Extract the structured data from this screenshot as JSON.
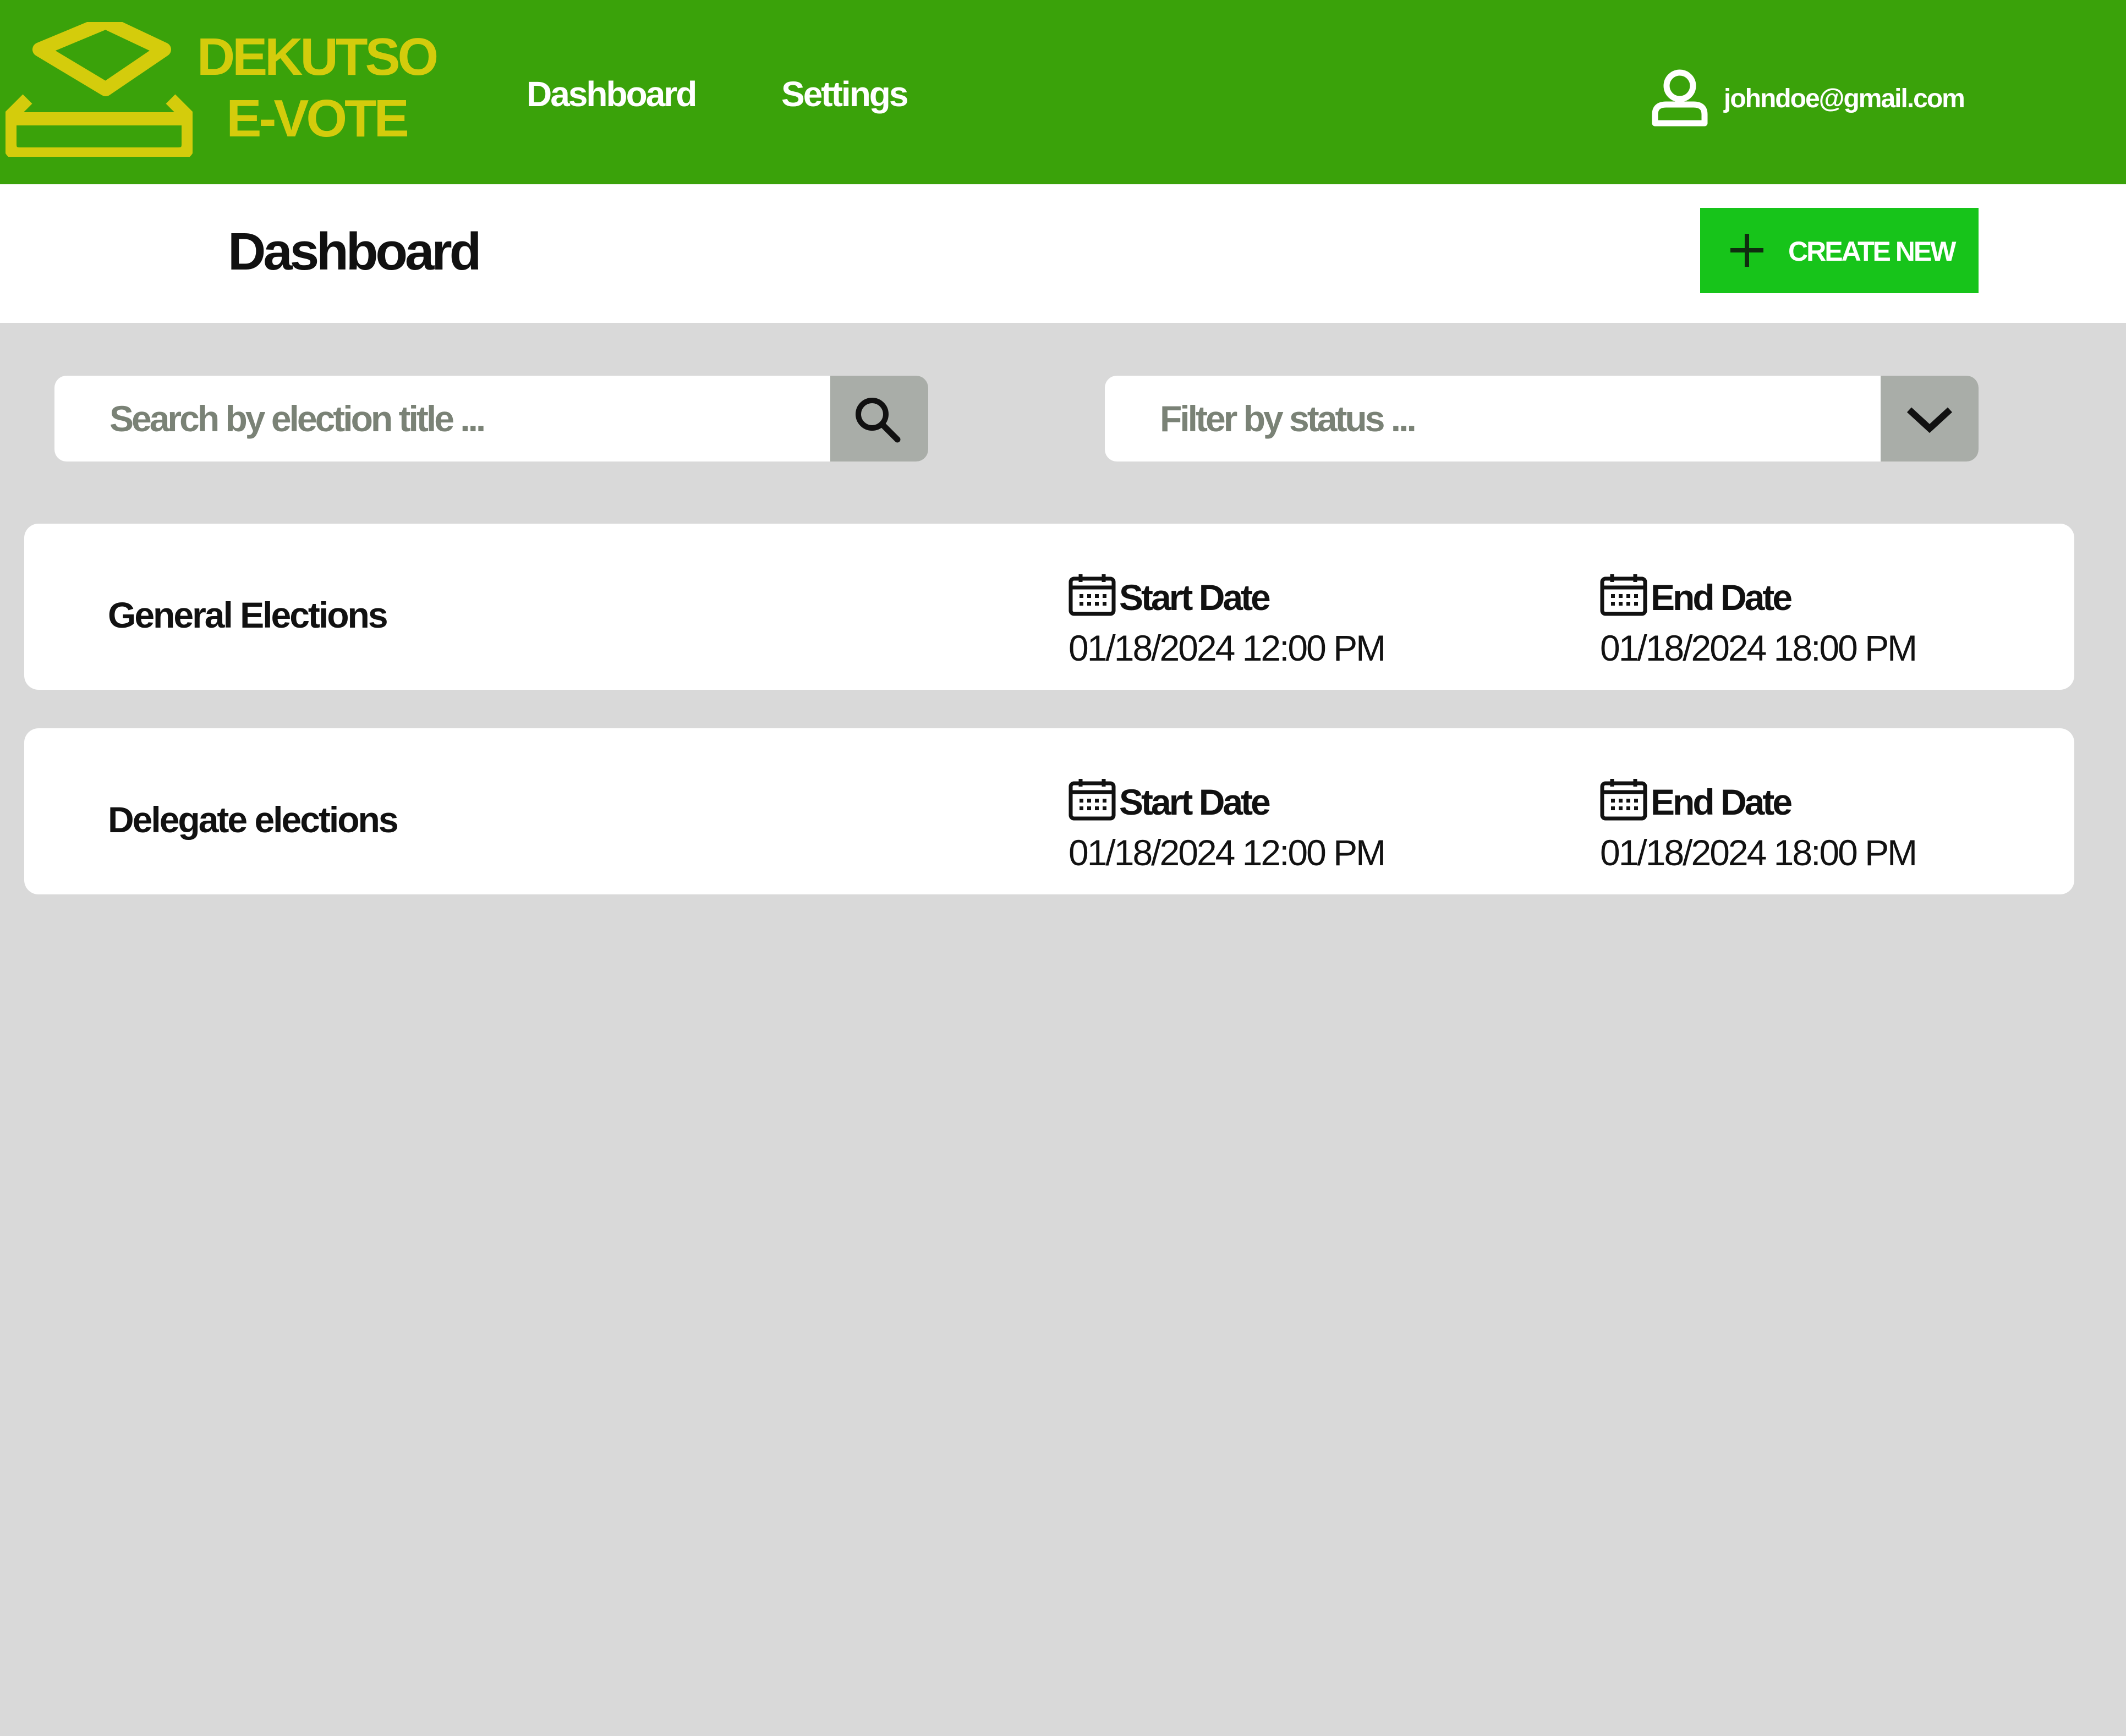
{
  "brand": {
    "line1": "DEKUTSO",
    "line2": "E-VOTE"
  },
  "nav": [
    {
      "label": "Dashboard"
    },
    {
      "label": "Settings"
    }
  ],
  "user": {
    "email": "johndoe@gmail.com",
    "icon": "user-icon"
  },
  "page": {
    "title": "Dashboard"
  },
  "actions": {
    "create_label": "CREATE NEW",
    "icon": "plus-icon"
  },
  "search": {
    "placeholder": "Search by election title ...",
    "value": "",
    "icon": "search-icon"
  },
  "filter": {
    "placeholder": "Filter by status ...",
    "value": "",
    "icon": "chevron-down-icon"
  },
  "elections": [
    {
      "title": "General Elections",
      "start_label": "Start Date",
      "start": "01/18/2024 12:00 PM",
      "end_label": "End Date",
      "end": "01/18/2024 18:00 PM"
    },
    {
      "title": "Delegate elections",
      "start_label": "Start Date",
      "start": "01/18/2024 12:00 PM",
      "end_label": "End Date",
      "end": "01/18/2024 18:00 PM"
    }
  ],
  "colors": {
    "topbar": "#3aa20a",
    "brand": "#d4cc0c",
    "create_button": "#17c41a",
    "field_button": "#a9ada8",
    "page_background": "#d9d9d9"
  }
}
